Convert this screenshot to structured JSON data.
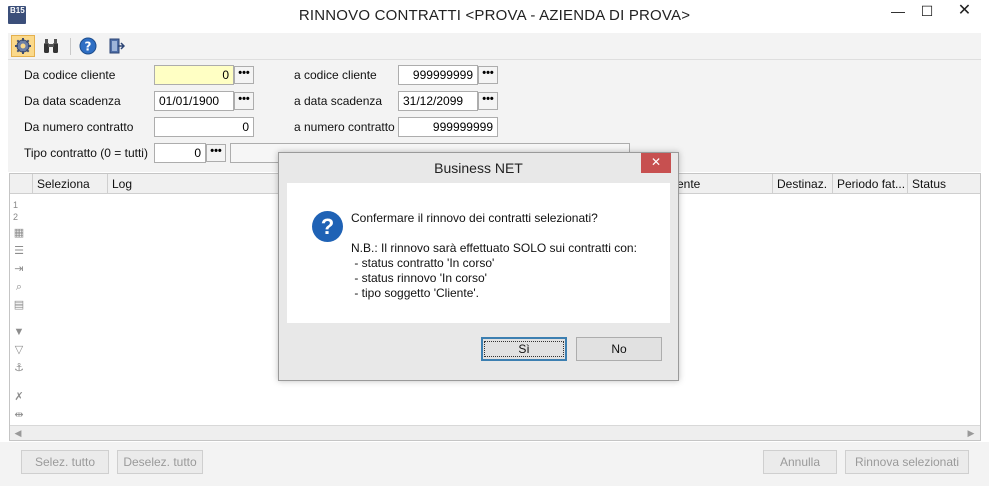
{
  "window": {
    "title": "RINNOVO CONTRATTI <PROVA - AZIENDA DI PROVA>",
    "app_icon_text": "B15",
    "minimize_glyph": "—",
    "maximize_glyph": "☐",
    "close_glyph": "✕"
  },
  "toolbar": {
    "buttons": [
      {
        "name": "settings",
        "icon": "gear-icon"
      },
      {
        "name": "find",
        "icon": "binoculars-icon"
      },
      {
        "name": "help",
        "icon": "help-icon"
      },
      {
        "name": "exit",
        "icon": "exit-door-icon"
      }
    ]
  },
  "filters": {
    "da_codice_cliente": {
      "label": "Da codice cliente",
      "value": "0"
    },
    "a_codice_cliente": {
      "label": "a codice cliente",
      "value": "999999999"
    },
    "da_data_scadenza": {
      "label": "Da data scadenza",
      "value": "01/01/1900"
    },
    "a_data_scadenza": {
      "label": "a data scadenza",
      "value": "31/12/2099"
    },
    "da_numero_contratto": {
      "label": "Da numero contratto",
      "value": "0"
    },
    "a_numero_contratto": {
      "label": "a numero contratto",
      "value": "999999999"
    },
    "tipo_contratto": {
      "label": "Tipo contratto (0 = tutti)",
      "value": "0",
      "description": ""
    },
    "ellipsis": "•••"
  },
  "grid": {
    "columns": [
      "Seleziona",
      "Log",
      "ente",
      "Destinaz.",
      "Periodo fat...",
      "Status"
    ],
    "row_numbers": [
      "1",
      "2"
    ]
  },
  "bottom": {
    "select_all": "Selez. tutto",
    "deselect_all": "Deselez. tutto",
    "cancel": "Annulla",
    "renew_selected": "Rinnova selezionati"
  },
  "dialog": {
    "title": "Business NET",
    "close_glyph": "✕",
    "icon_glyph": "?",
    "question": "Confermare il rinnovo dei contratti selezionati?",
    "note_lines": [
      "N.B.: Il rinnovo sarà effettuato SOLO sui contratti con:",
      " - status contratto 'In corso'",
      " - status rinnovo 'In corso'",
      " - tipo soggetto 'Cliente'."
    ],
    "yes_label": "Sì",
    "no_label": "No"
  }
}
